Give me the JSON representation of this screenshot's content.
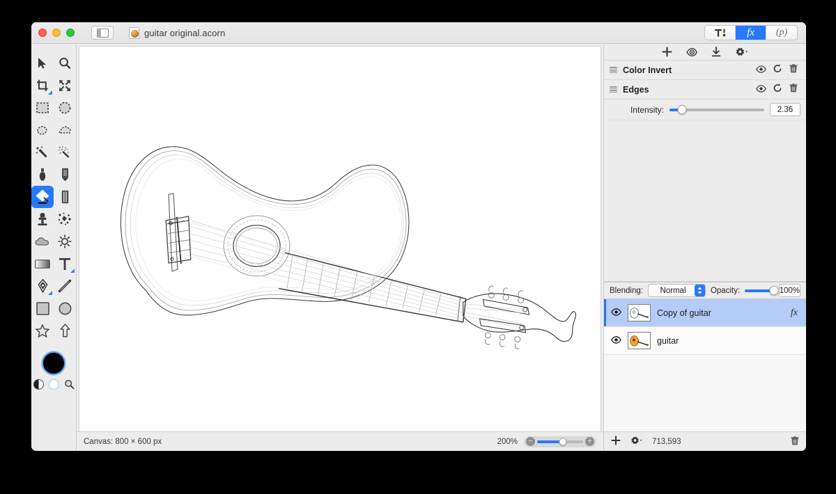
{
  "window": {
    "title": "guitar original.acorn",
    "traffic_lights": [
      "close",
      "minimize",
      "zoom"
    ],
    "sidebar_toggle": "sidebar-toggle",
    "doc_icon": "acorn-document-icon"
  },
  "inspector_tabs": [
    {
      "id": "tools",
      "icon": "hammer-tool-icon",
      "label": "",
      "active": false
    },
    {
      "id": "filters",
      "icon": "fx-icon",
      "label": "fx",
      "active": true
    },
    {
      "id": "presets",
      "icon": "presets-icon",
      "label": "(p)",
      "active": false
    }
  ],
  "tool_palette": {
    "tools": [
      {
        "name": "move-tool",
        "icon": "arrow-cursor-icon",
        "selected": false,
        "badge": false
      },
      {
        "name": "zoom-tool",
        "icon": "magnifier-plus-icon",
        "selected": false,
        "badge": false
      },
      {
        "name": "crop-tool",
        "icon": "crop-icon",
        "selected": false,
        "badge": true
      },
      {
        "name": "transform-tool",
        "icon": "four-arrows-icon",
        "selected": false,
        "badge": false
      },
      {
        "name": "rectangular-select-tool",
        "icon": "dashed-rectangle-icon",
        "selected": false,
        "badge": false
      },
      {
        "name": "elliptical-select-tool",
        "icon": "dashed-circle-icon",
        "selected": false,
        "badge": false
      },
      {
        "name": "lasso-select-tool",
        "icon": "lasso-icon",
        "selected": false,
        "badge": false
      },
      {
        "name": "polygon-select-tool",
        "icon": "polygon-lasso-icon",
        "selected": false,
        "badge": false
      },
      {
        "name": "magic-wand-tool",
        "icon": "magic-wand-icon",
        "selected": false,
        "badge": false
      },
      {
        "name": "instant-alpha-tool",
        "icon": "sparkle-wand-icon",
        "selected": false,
        "badge": false
      },
      {
        "name": "brush-tool",
        "icon": "paintbrush-icon",
        "selected": false,
        "badge": false
      },
      {
        "name": "pencil-tool",
        "icon": "pencil-icon",
        "selected": false,
        "badge": false
      },
      {
        "name": "paint-bucket-tool",
        "icon": "paint-bucket-icon",
        "selected": true,
        "badge": false
      },
      {
        "name": "eraser-tool",
        "icon": "eraser-icon",
        "selected": false,
        "badge": false
      },
      {
        "name": "clone-stamp-tool",
        "icon": "clone-stamp-icon",
        "selected": false,
        "badge": false
      },
      {
        "name": "smudge-tool",
        "icon": "splatter-icon",
        "selected": false,
        "badge": false
      },
      {
        "name": "blur-tool",
        "icon": "cloud-blur-icon",
        "selected": false,
        "badge": false
      },
      {
        "name": "dodge-burn-tool",
        "icon": "sun-dodge-icon",
        "selected": false,
        "badge": false
      },
      {
        "name": "gradient-tool",
        "icon": "gradient-icon",
        "selected": false,
        "badge": false
      },
      {
        "name": "text-tool",
        "icon": "text-t-icon",
        "selected": false,
        "badge": true
      },
      {
        "name": "bezier-pen-tool",
        "icon": "pen-nib-icon",
        "selected": false,
        "badge": true
      },
      {
        "name": "line-tool",
        "icon": "line-icon",
        "selected": false,
        "badge": false
      },
      {
        "name": "rectangle-shape-tool",
        "icon": "rectangle-icon",
        "selected": false,
        "badge": false
      },
      {
        "name": "ellipse-shape-tool",
        "icon": "ellipse-icon",
        "selected": false,
        "badge": false
      },
      {
        "name": "star-shape-tool",
        "icon": "star-icon",
        "selected": false,
        "badge": false
      },
      {
        "name": "arrow-shape-tool",
        "icon": "arrow-up-icon",
        "selected": false,
        "badge": false
      }
    ],
    "foreground_color": "#000000",
    "background_color": "#ffffff",
    "swap_icon": "swap-colors-icon",
    "picker_icon": "color-picker-magnifier-icon"
  },
  "canvas": {
    "status": "Canvas: 800 × 600 px",
    "zoom_level": "200%",
    "zoom_out_icon": "zoom-out-icon",
    "zoom_in_icon": "zoom-in-icon",
    "zoom_slider_percent": 56,
    "artwork": "guitar-line-drawing"
  },
  "filters": {
    "toolbar": [
      {
        "name": "add-filter-button",
        "icon": "plus-icon"
      },
      {
        "name": "preview-filter-button",
        "icon": "eye-target-icon"
      },
      {
        "name": "load-filter-button",
        "icon": "download-arrow-icon"
      },
      {
        "name": "filter-settings-button",
        "icon": "gear-dropdown-icon"
      }
    ],
    "items": [
      {
        "name": "Color Invert",
        "grip": "drag-handle-icon",
        "actions": [
          {
            "name": "toggle-visibility",
            "icon": "eye-icon"
          },
          {
            "name": "reset-filter",
            "icon": "reset-arrow-icon"
          },
          {
            "name": "delete-filter",
            "icon": "trash-icon"
          }
        ],
        "params": []
      },
      {
        "name": "Edges",
        "grip": "drag-handle-icon",
        "actions": [
          {
            "name": "toggle-visibility",
            "icon": "eye-icon"
          },
          {
            "name": "reset-filter",
            "icon": "reset-arrow-icon"
          },
          {
            "name": "delete-filter",
            "icon": "trash-icon"
          }
        ],
        "params": [
          {
            "label": "Intensity:",
            "value": "2.36",
            "slider_percent": 13
          }
        ]
      }
    ]
  },
  "layers": {
    "blending_label": "Blending:",
    "blending_value": "Normal",
    "opacity_label": "Opacity:",
    "opacity_value": "100%",
    "opacity_percent": 100,
    "items": [
      {
        "name": "Copy of guitar",
        "selected": true,
        "visible": true,
        "visibility_icon": "eye-icon",
        "thumbnail": "guitar-thumbnail-grayscale",
        "has_fx": true,
        "fx_label": "fx"
      },
      {
        "name": "guitar",
        "selected": false,
        "visible": true,
        "visibility_icon": "eye-icon",
        "thumbnail": "guitar-thumbnail-color",
        "has_fx": false,
        "fx_label": ""
      }
    ],
    "bottom_bar": {
      "add_layer_icon": "plus-icon",
      "layer_settings_icon": "gear-dropdown-icon",
      "pixel_count": "713,593",
      "delete_layer_icon": "trash-icon"
    }
  },
  "colors": {
    "accent": "#2878fa",
    "window_chrome": "#ececec",
    "selected_layer_bg": "#b4ccf7",
    "canvas_bg": "#ffffff",
    "desktop_bg": "#000000"
  }
}
